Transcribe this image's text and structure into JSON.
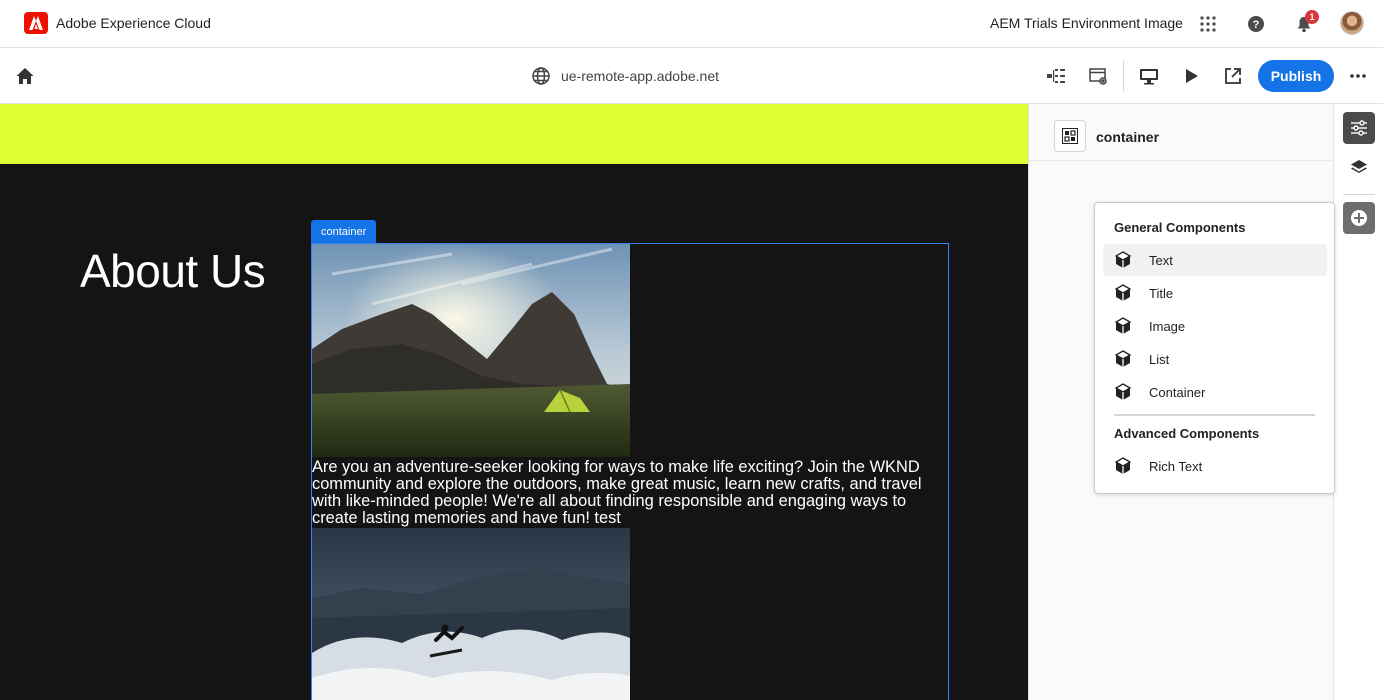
{
  "shell": {
    "brand": "Adobe Experience Cloud",
    "org": "AEM Trials Environment Image",
    "notifications_count": "1"
  },
  "toolbar": {
    "url": "ue-remote-app.adobe.net",
    "publish_label": "Publish"
  },
  "canvas": {
    "heading": "About Us",
    "container_tag": "container",
    "paragraph": "Are you an adventure-seeker looking for ways to make life exciting? Join the WKND community and explore the outdoors, make great music, learn new crafts, and travel with like-minded people! We're all about finding responsible and engaging ways to create lasting memories and have fun! test",
    "lime_color": "#deff33"
  },
  "panel": {
    "title": "container"
  },
  "add_menu": {
    "general_heading": "General Components",
    "general_items": [
      "Text",
      "Title",
      "Image",
      "List",
      "Container"
    ],
    "advanced_heading": "Advanced Components",
    "advanced_items": [
      "Rich Text"
    ]
  },
  "colors": {
    "accent": "#1473e6",
    "brand_red": "#eb1000"
  },
  "icons": {
    "shell": [
      "adobe-logo-icon",
      "apps-grid-icon",
      "help-icon",
      "bell-icon",
      "avatar"
    ],
    "toolbar": [
      "home-icon",
      "globe-icon",
      "content-tree-icon",
      "properties-icon",
      "desktop-icon",
      "preview-play-icon",
      "open-external-icon",
      "more-icon"
    ],
    "rail": [
      "properties-sliders-icon",
      "layers-icon",
      "add-circle-icon"
    ]
  }
}
